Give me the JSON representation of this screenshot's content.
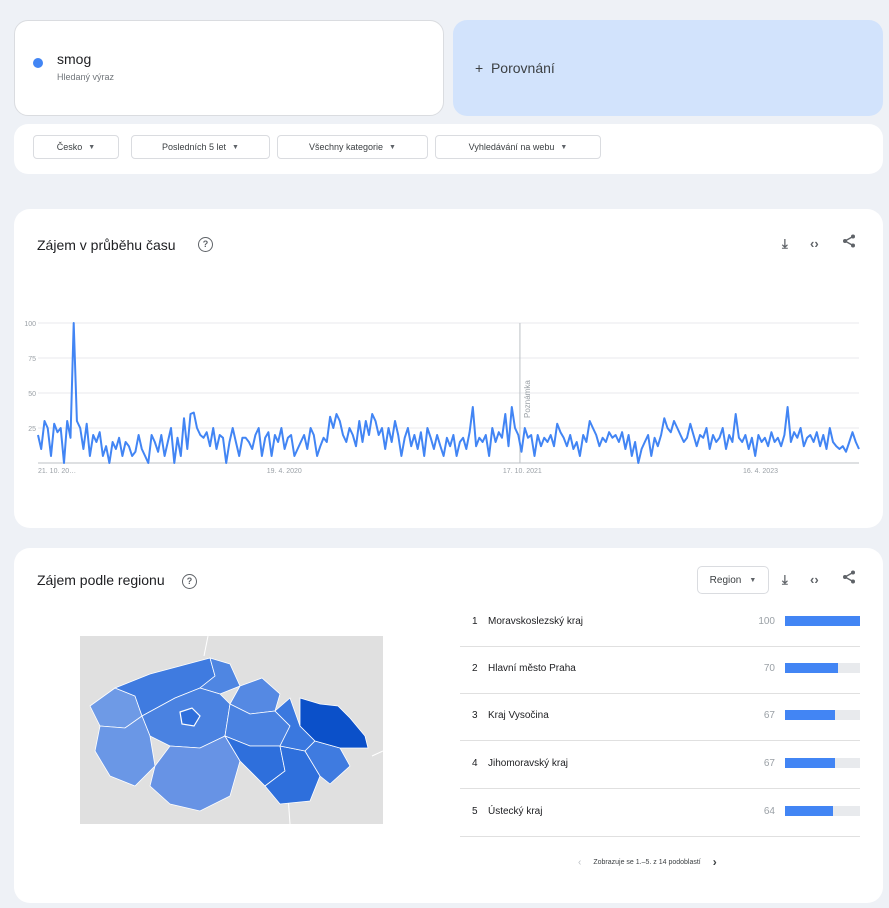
{
  "search_term": {
    "name": "smog",
    "type": "Hledaný výraz"
  },
  "compare": {
    "label": "Porovnání",
    "plus": "+"
  },
  "filters": [
    {
      "label": "Česko"
    },
    {
      "label": "Posledních 5 let"
    },
    {
      "label": "Všechny kategorie"
    },
    {
      "label": "Vyhledávání na webu"
    }
  ],
  "interest_over_time": {
    "title": "Zájem v průběhu času",
    "note_label": "Poznámka"
  },
  "interest_by_region": {
    "title": "Zájem podle regionu",
    "region_selector": "Region",
    "rows": [
      {
        "rank": "1",
        "name": "Moravskoslezský kraj",
        "value": "100",
        "level": 100
      },
      {
        "rank": "2",
        "name": "Hlavní město Praha",
        "value": "70",
        "level": 70
      },
      {
        "rank": "3",
        "name": "Kraj Vysočina",
        "value": "67",
        "level": 67
      },
      {
        "rank": "4",
        "name": "Jihomoravský kraj",
        "value": "67",
        "level": 67
      },
      {
        "rank": "5",
        "name": "Ústecký kraj",
        "value": "64",
        "level": 64
      }
    ],
    "pager_text": "Zobrazuje se 1.–5. z 14 podoblastí"
  },
  "icons": {
    "download": "download-icon",
    "embed": "embed-icon",
    "share": "share-icon",
    "help": "help-icon"
  },
  "colors": {
    "accent": "#4285f4",
    "compare_bg": "#d2e3fc",
    "map_dark": "#1a5fd1"
  },
  "chart_data": {
    "type": "line",
    "x_tick_labels": [
      "21. 10. 20…",
      "19. 4. 2020",
      "17. 10. 2021",
      "16. 4. 2023"
    ],
    "y_ticks": [
      25,
      50,
      75,
      100
    ],
    "ylim": [
      0,
      100
    ],
    "series": [
      {
        "values": [
          20,
          10,
          30,
          25,
          5,
          28,
          22,
          25,
          0,
          30,
          18,
          100,
          30,
          25,
          10,
          28,
          5,
          20,
          15,
          22,
          5,
          12,
          0,
          15,
          10,
          18,
          5,
          15,
          12,
          5,
          8,
          20,
          10,
          5,
          0,
          20,
          15,
          8,
          20,
          5,
          15,
          25,
          0,
          18,
          5,
          32,
          10,
          35,
          36,
          25,
          20,
          18,
          22,
          12,
          25,
          10,
          20,
          18,
          0,
          15,
          25,
          15,
          5,
          18,
          18,
          15,
          10,
          20,
          25,
          5,
          18,
          22,
          5,
          20,
          15,
          25,
          10,
          18,
          20,
          5,
          10,
          15,
          20,
          10,
          25,
          20,
          5,
          12,
          18,
          15,
          33,
          25,
          35,
          30,
          20,
          15,
          25,
          20,
          12,
          30,
          15,
          30,
          20,
          35,
          30,
          20,
          25,
          10,
          25,
          15,
          30,
          20,
          5,
          18,
          25,
          12,
          20,
          10,
          22,
          5,
          25,
          18,
          10,
          20,
          12,
          5,
          18,
          12,
          20,
          5,
          15,
          18,
          10,
          22,
          40,
          12,
          18,
          15,
          20,
          5,
          25,
          15,
          22,
          18,
          35,
          12,
          40,
          25,
          20,
          8,
          25,
          18,
          20,
          5,
          20,
          12,
          18,
          15,
          20,
          12,
          28,
          22,
          18,
          12,
          20,
          10,
          15,
          5,
          20,
          15,
          30,
          25,
          20,
          12,
          18,
          15,
          22,
          18,
          20,
          15,
          22,
          10,
          20,
          5,
          15,
          0,
          10,
          15,
          20,
          5,
          18,
          12,
          20,
          32,
          25,
          22,
          30,
          25,
          20,
          15,
          18,
          28,
          20,
          12,
          20,
          18,
          25,
          10,
          20,
          15,
          18,
          25,
          10,
          20,
          15,
          35,
          18,
          15,
          20,
          10,
          18,
          5,
          20,
          15,
          18,
          12,
          22,
          15,
          18,
          12,
          20,
          40,
          15,
          22,
          18,
          25,
          12,
          18,
          20,
          15,
          22,
          12,
          20,
          10,
          25,
          15,
          12,
          10,
          12,
          8,
          15,
          22,
          15,
          10
        ]
      }
    ]
  }
}
